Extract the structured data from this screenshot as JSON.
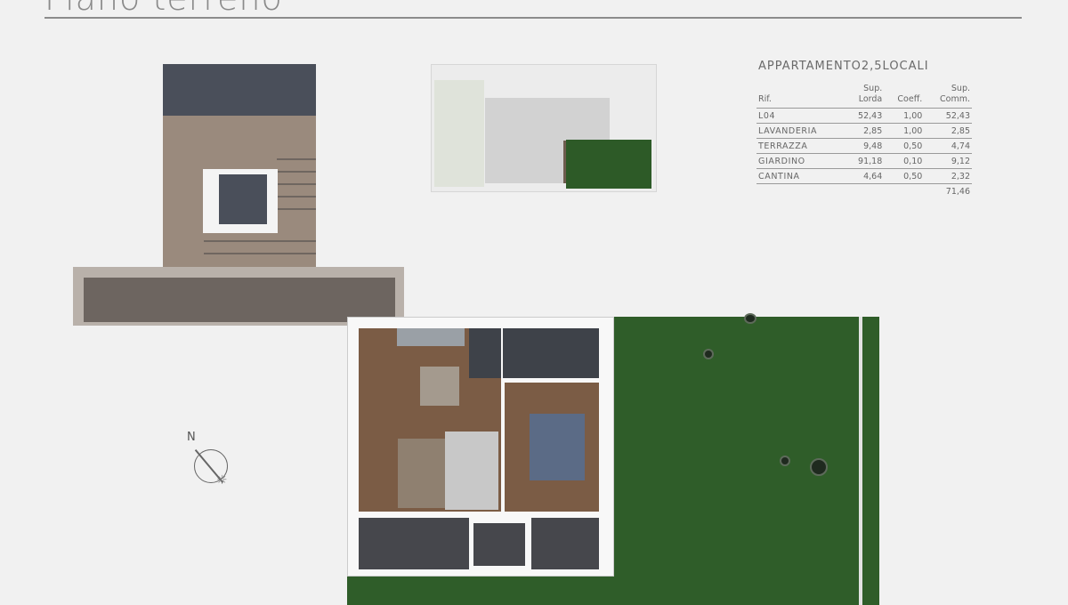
{
  "page": {
    "title": "Piano terreno"
  },
  "apartment": {
    "title": "APPARTAMENTO2,5LOCALI",
    "columns": {
      "rif": "Rif.",
      "sup_lorda": [
        "Sup.",
        "Lorda"
      ],
      "coeff": "Coeff.",
      "sup_comm": [
        "Sup.",
        "Comm."
      ]
    },
    "rows": [
      {
        "name": "L04",
        "lorda": "52,43",
        "coeff": "1,00",
        "comm": "52,43"
      },
      {
        "name": "LAVANDERIA",
        "lorda": "2,85",
        "coeff": "1,00",
        "comm": "2,85"
      },
      {
        "name": "TERRAZZA",
        "lorda": "9,48",
        "coeff": "0,50",
        "comm": "4,74"
      },
      {
        "name": "GIARDINO",
        "lorda": "91,18",
        "coeff": "0,10",
        "comm": "9,12"
      },
      {
        "name": "CANTINA",
        "lorda": "4,64",
        "coeff": "0,50",
        "comm": "2,32"
      }
    ],
    "total": "71,46"
  },
  "compass": {
    "north_label": "N",
    "icon": "compass-icon"
  },
  "colors": {
    "background": "#f1f1f1",
    "garden": "#2f5d29",
    "floor": "#7b5c45",
    "rule": "#8c8c8c"
  }
}
